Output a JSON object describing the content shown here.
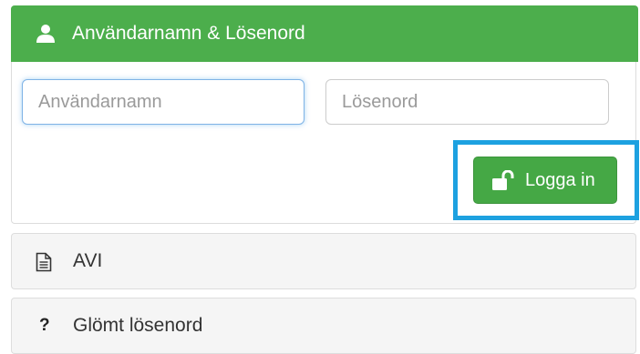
{
  "login_panel": {
    "title": "Användarnamn & Lösenord",
    "header_icon": "user-icon",
    "username_placeholder": "Användarnamn",
    "username_value": "",
    "password_placeholder": "Lösenord",
    "password_value": "",
    "login_button_label": "Logga in",
    "login_button_icon": "unlock-icon"
  },
  "options": {
    "avi_label": "AVI",
    "avi_icon": "document-icon",
    "forgot_label": "Glömt lösenord",
    "forgot_icon": "question-icon",
    "forgot_icon_glyph": "?"
  },
  "colors": {
    "header_green": "#4cae4c",
    "button_green": "#45a845",
    "highlight_blue": "#1da1e0"
  }
}
